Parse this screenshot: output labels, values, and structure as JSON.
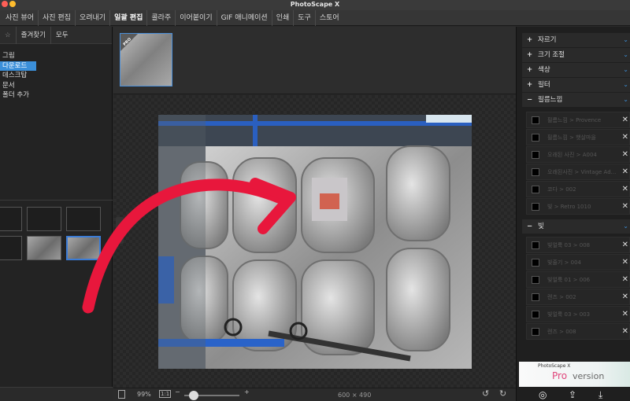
{
  "app": {
    "title": "PhotoScape X"
  },
  "menu": {
    "tabs": [
      "사진 뷰어",
      "사진 편집",
      "오려내기",
      "일괄 편집",
      "콜라주",
      "이어붙이기",
      "GIF 애니메이션",
      "인쇄",
      "도구",
      "스토어"
    ],
    "active": "일괄 편집"
  },
  "left": {
    "tabs": {
      "favorites": "즐겨찾기",
      "all": "모두"
    },
    "folders": [
      "그림",
      "다운로드",
      "데스크탑",
      "문서",
      "폴더 추가"
    ],
    "selected_folder": "다운로드"
  },
  "center": {
    "pro_badge": "PRO",
    "zoom": "99%",
    "fit_label": "1:1",
    "dimensions": "600 × 490"
  },
  "right": {
    "sections": [
      "자르기",
      "크기 조절",
      "색상",
      "필터",
      "필름느낌"
    ],
    "film_items": [
      "필름느낌 > Provence",
      "필름느낌 > 햇살마을",
      "오래된 사진 > A004",
      "오래된사진 > Vintage Ad...",
      "코다 > 002",
      "빛 > Retro 1010"
    ],
    "light_header": "빛",
    "light_items": [
      "빛얼룩 03 > 008",
      "빛줄기 > 004",
      "빛얼룩 01 > 006",
      "렌즈 > 002",
      "빛얼룩 03 > 003",
      "렌즈 > 008"
    ],
    "ad": {
      "small": "PhotoScape X",
      "pro": "Pro",
      "version": "version"
    }
  },
  "colors": {
    "accent": "#3b8fd9",
    "selection": "#3b8fd9",
    "arrow": "#e8173c",
    "pro": "#e0457b"
  }
}
